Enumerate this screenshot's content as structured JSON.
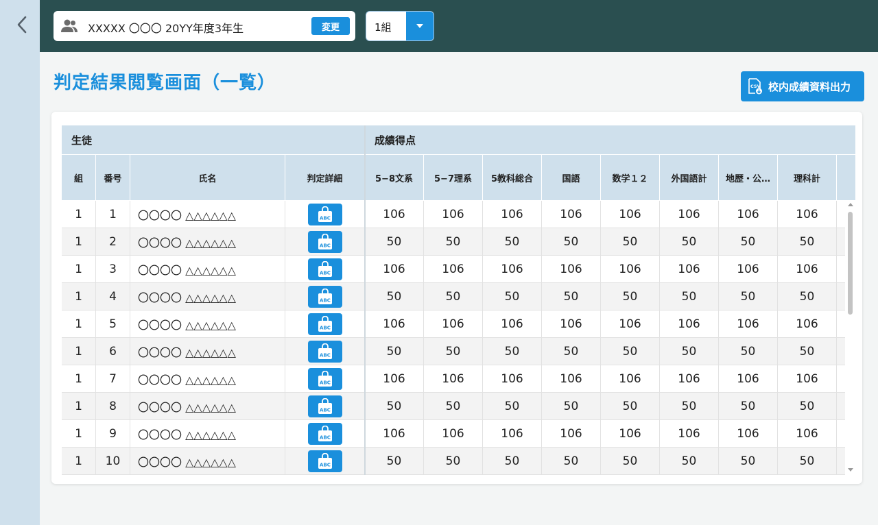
{
  "header": {
    "student_label": "XXXXX 〇〇〇 20YY年度3年生",
    "change_label": "変更",
    "class_value": "1組"
  },
  "page": {
    "title": "判定結果閲覧画面（一覧）",
    "csv_button_label": "校内成績資料出力"
  },
  "table": {
    "group_headers": [
      "生徒",
      "成績得点"
    ],
    "columns": [
      "組",
      "番号",
      "氏名",
      "判定詳細",
      "5−8文系",
      "5−7理系",
      "5教科総合",
      "国語",
      "数学１２",
      "外国語計",
      "地歴・公…",
      "理科計"
    ],
    "rows": [
      {
        "kumi": "1",
        "no": "1",
        "name": "〇〇〇〇 △△△△△△",
        "scores": [
          "106",
          "106",
          "106",
          "106",
          "106",
          "106",
          "106",
          "106"
        ]
      },
      {
        "kumi": "1",
        "no": "2",
        "name": "〇〇〇〇 △△△△△△",
        "scores": [
          "50",
          "50",
          "50",
          "50",
          "50",
          "50",
          "50",
          "50"
        ]
      },
      {
        "kumi": "1",
        "no": "3",
        "name": "〇〇〇〇 △△△△△△",
        "scores": [
          "106",
          "106",
          "106",
          "106",
          "106",
          "106",
          "106",
          "106"
        ]
      },
      {
        "kumi": "1",
        "no": "4",
        "name": "〇〇〇〇 △△△△△△",
        "scores": [
          "50",
          "50",
          "50",
          "50",
          "50",
          "50",
          "50",
          "50"
        ]
      },
      {
        "kumi": "1",
        "no": "5",
        "name": "〇〇〇〇 △△△△△△",
        "scores": [
          "106",
          "106",
          "106",
          "106",
          "106",
          "106",
          "106",
          "106"
        ]
      },
      {
        "kumi": "1",
        "no": "6",
        "name": "〇〇〇〇 △△△△△△",
        "scores": [
          "50",
          "50",
          "50",
          "50",
          "50",
          "50",
          "50",
          "50"
        ]
      },
      {
        "kumi": "1",
        "no": "7",
        "name": "〇〇〇〇 △△△△△△",
        "scores": [
          "106",
          "106",
          "106",
          "106",
          "106",
          "106",
          "106",
          "106"
        ]
      },
      {
        "kumi": "1",
        "no": "8",
        "name": "〇〇〇〇 △△△△△△",
        "scores": [
          "50",
          "50",
          "50",
          "50",
          "50",
          "50",
          "50",
          "50"
        ]
      },
      {
        "kumi": "1",
        "no": "9",
        "name": "〇〇〇〇 △△△△△△",
        "scores": [
          "106",
          "106",
          "106",
          "106",
          "106",
          "106",
          "106",
          "106"
        ]
      },
      {
        "kumi": "1",
        "no": "10",
        "name": "〇〇〇〇 △△△△△△",
        "scores": [
          "50",
          "50",
          "50",
          "50",
          "50",
          "50",
          "50",
          "50"
        ]
      }
    ]
  },
  "icons": {
    "back": "chevron-left-icon",
    "people": "people-icon",
    "csv": "csv-file-icon",
    "detail": "abc-bag-icon",
    "dropdown": "caret-down-icon"
  },
  "colors": {
    "accent": "#1a8fdc",
    "topbar": "#2a4f50",
    "rail": "#cfe0ec",
    "header_cell": "#cfe0ec"
  }
}
